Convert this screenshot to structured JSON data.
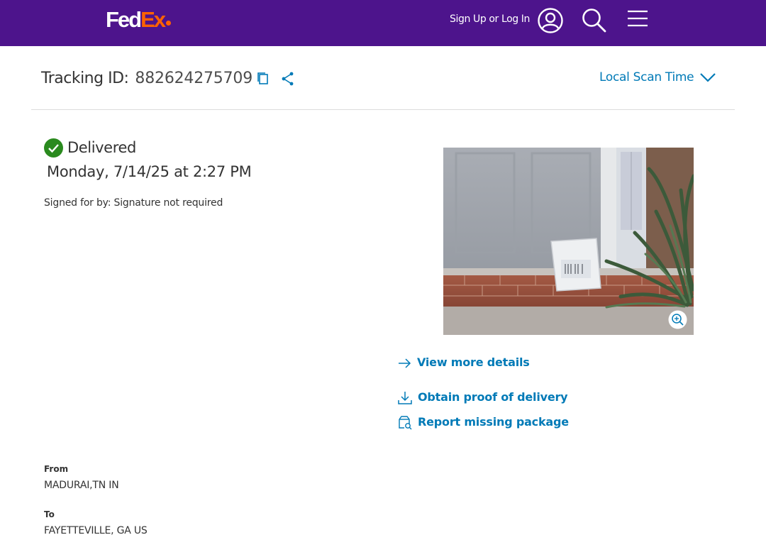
{
  "header": {
    "logo_primary": "Fed",
    "logo_secondary": "Ex",
    "signin_label": "Sign Up or Log In",
    "brand_purple": "#4d148c",
    "brand_orange": "#ff6200"
  },
  "tracking": {
    "label": "Tracking ID:",
    "id": "882624275709",
    "scan_time_label": "Local Scan Time"
  },
  "status": {
    "label": "Delivered",
    "date": "Monday, 7/14/25 at 2:27 PM",
    "signed": "Signed for by: Signature not required",
    "status_color": "#2a8a1e"
  },
  "actions": {
    "view_details": "View more details",
    "proof_of_delivery": "Obtain proof of delivery",
    "report_missing": "Report missing package",
    "link_color": "#007ab7"
  },
  "shipment": {
    "from_label": "From",
    "from_value": "MADURAI,TN IN",
    "to_label": "To",
    "to_value": "FAYETTEVILLE, GA US"
  },
  "icons": [
    "user-icon",
    "search-icon",
    "menu-icon",
    "copy-icon",
    "share-icon",
    "chevron-down-icon",
    "check-circle-icon",
    "zoom-in-icon",
    "arrow-right-icon",
    "download-icon",
    "missing-package-icon"
  ]
}
